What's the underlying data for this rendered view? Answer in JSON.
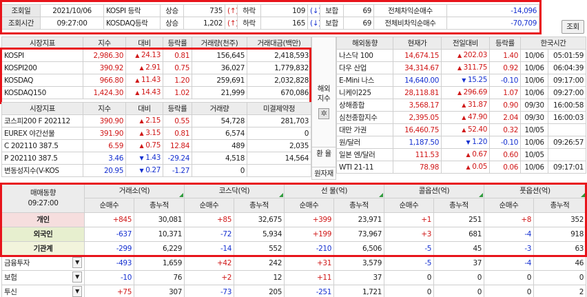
{
  "summary": {
    "date_label": "조회일",
    "date_value": "2021/10/06",
    "time_label": "조회시간",
    "time_value": "09:27:00",
    "rows": [
      {
        "market": "KOSPI 등락",
        "rise_label": "상승",
        "rise": "735",
        "rise_arrow": "(↑)",
        "fall_label": "하락",
        "fall": "109",
        "fall_arrow": "(↓)",
        "flat_label": "보합",
        "flat": "69",
        "arb_label": "전체차익순매수",
        "arb": "-14,096"
      },
      {
        "market": "KOSDAQ등락",
        "rise_label": "상승",
        "rise": "1,202",
        "rise_arrow": "(↑)",
        "fall_label": "하락",
        "fall": "165",
        "fall_arrow": "(↓)",
        "flat_label": "보합",
        "flat": "69",
        "arb_label": "전체비차익순매수",
        "arb": "-70,709"
      }
    ],
    "query_button": "조회"
  },
  "market_index": {
    "headers": [
      "시장지표",
      "지수",
      "대비",
      "등락률",
      "거래량(천주)",
      "거래대금(백만)"
    ],
    "rows": [
      {
        "name": "KOSPI",
        "index": "2,986.30",
        "dir": "▲",
        "change": "24.13",
        "rate": "0.81",
        "volume": "156,645",
        "amount": "2,418,593"
      },
      {
        "name": "KOSPI200",
        "index": "390.92",
        "dir": "▲",
        "change": "2.91",
        "rate": "0.75",
        "volume": "36,027",
        "amount": "1,779,832"
      },
      {
        "name": "KOSDAQ",
        "index": "966.80",
        "dir": "▲",
        "change": "11.43",
        "rate": "1.20",
        "volume": "259,691",
        "amount": "2,032,828"
      },
      {
        "name": "KOSDAQ150",
        "index": "1,424.30",
        "dir": "▲",
        "change": "14.43",
        "rate": "1.02",
        "volume": "21,999",
        "amount": "670,086"
      }
    ]
  },
  "futures": {
    "headers": [
      "시장지표",
      "지수",
      "대비",
      "등락률",
      "거래량",
      "미결제약정"
    ],
    "rows": [
      {
        "name": "코스피200 F 202112",
        "index": "390.90",
        "dir": "▲",
        "change": "2.15",
        "rate": "0.55",
        "volume": "54,728",
        "oi": "281,703",
        "color": "red"
      },
      {
        "name": "EUREX 야간선물",
        "index": "391.90",
        "dir": "▲",
        "change": "3.15",
        "rate": "0.81",
        "volume": "6,574",
        "oi": "0",
        "color": "red"
      },
      {
        "name": "C 202110 387.5",
        "index": "6.59",
        "dir": "▲",
        "change": "0.75",
        "rate": "12.84",
        "volume": "489",
        "oi": "2,035",
        "color": "red"
      },
      {
        "name": "P 202110 387.5",
        "index": "3.46",
        "dir": "▼",
        "change": "1.43",
        "rate": "-29.24",
        "volume": "4,518",
        "oi": "14,564",
        "color": "blu"
      },
      {
        "name": "변동성지수(V-KOS",
        "index": "20.95",
        "dir": "▼",
        "change": "0.27",
        "rate": "-1.27",
        "volume": "0",
        "oi": "",
        "color": "blu"
      }
    ]
  },
  "side_labels": {
    "overseas": "해외\n지수",
    "exchange": "환  율",
    "commodity": "원자재"
  },
  "overseas": {
    "headers": [
      "해외동향",
      "현재가",
      "전일대비",
      "등락률",
      "한국시간"
    ],
    "rows": [
      {
        "name": "나스닥 100",
        "price": "14,674.15",
        "dir": "▲",
        "change": "202.03",
        "rate": "1.40",
        "date": "10/06",
        "time": "05:01:59",
        "color": "red"
      },
      {
        "name": "다우 산업",
        "price": "34,314.67",
        "dir": "▲",
        "change": "311.75",
        "rate": "0.92",
        "date": "10/06",
        "time": "06:04:39",
        "color": "red"
      },
      {
        "name": "E-Mini 나스",
        "price": "14,640.00",
        "dir": "▼",
        "change": "15.25",
        "rate": "-0.10",
        "date": "10/06",
        "time": "09:17:00",
        "color": "blu"
      },
      {
        "name": "니케이225",
        "price": "28,118.81",
        "dir": "▲",
        "change": "296.69",
        "rate": "1.07",
        "date": "10/06",
        "time": "09:27:00",
        "color": "red"
      },
      {
        "name": "상해종합",
        "price": "3,568.17",
        "dir": "▲",
        "change": "31.87",
        "rate": "0.90",
        "date": "09/30",
        "time": "16:00:58",
        "color": "red"
      },
      {
        "name": "심천종합지수",
        "price": "2,395.05",
        "dir": "▲",
        "change": "47.90",
        "rate": "2.04",
        "date": "09/30",
        "time": "16:00:03",
        "color": "red"
      },
      {
        "name": "대만 가권",
        "price": "16,460.75",
        "dir": "▲",
        "change": "52.40",
        "rate": "0.32",
        "date": "10/05",
        "time": "",
        "color": "red"
      },
      {
        "name": "원/달러",
        "price": "1,187.50",
        "dir": "▼",
        "change": "1.20",
        "rate": "-0.10",
        "date": "10/06",
        "time": "09:26:57",
        "color": "blu"
      },
      {
        "name": "일본 엔/달러",
        "price": "111.53",
        "dir": "▲",
        "change": "0.67",
        "rate": "0.60",
        "date": "10/05",
        "time": "",
        "color": "red"
      },
      {
        "name": "WTI 21-11",
        "price": "78.98",
        "dir": "▲",
        "change": "0.05",
        "rate": "0.06",
        "date": "10/06",
        "time": "09:17:01",
        "color": "red"
      }
    ]
  },
  "flow": {
    "title": "매매동향",
    "time": "09:27:00",
    "groups": [
      "거래소(억)",
      "코스닥(억)",
      "선   물(억)",
      "콜옵션(억)",
      "풋옵션(억)"
    ],
    "sub_headers": [
      "순매수",
      "총누적"
    ],
    "main_rows": [
      {
        "name": "개인",
        "bg": "pink",
        "vals": [
          "+845",
          "30,081",
          "+85",
          "32,675",
          "+399",
          "23,971",
          "+1",
          "251",
          "+8",
          "352"
        ]
      },
      {
        "name": "외국인",
        "bg": "green",
        "vals": [
          "-637",
          "10,371",
          "-72",
          "5,934",
          "+199",
          "73,967",
          "+3",
          "681",
          "-4",
          "918"
        ]
      },
      {
        "name": "기관계",
        "bg": "ylw",
        "vals": [
          "-299",
          "6,229",
          "-14",
          "552",
          "-210",
          "6,506",
          "-5",
          "45",
          "-3",
          "63"
        ]
      }
    ],
    "sub_rows": [
      {
        "name": "금융투자",
        "vals": [
          "-493",
          "1,659",
          "+42",
          "242",
          "+31",
          "3,579",
          "-5",
          "37",
          "-4",
          "46"
        ]
      },
      {
        "name": "보험",
        "vals": [
          "-10",
          "76",
          "+2",
          "12",
          "+11",
          "37",
          "0",
          "0",
          "0",
          "0"
        ]
      },
      {
        "name": "투신",
        "vals": [
          "+75",
          "307",
          "-73",
          "205",
          "-251",
          "1,721",
          "0",
          "0",
          "0",
          "2"
        ]
      }
    ]
  }
}
